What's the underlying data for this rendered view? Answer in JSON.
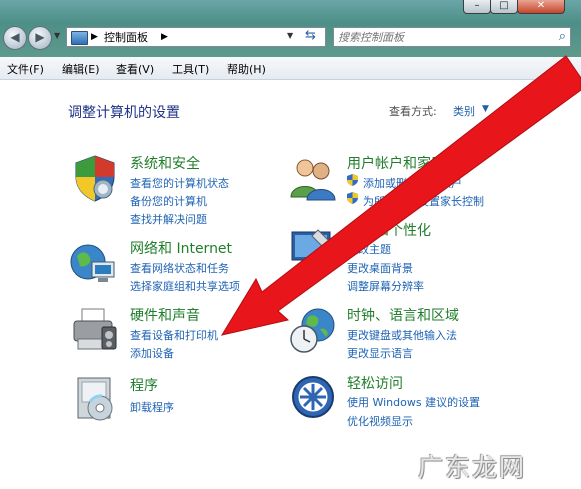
{
  "address": {
    "segments": [
      "控制面板"
    ],
    "search_placeholder": "搜索控制面板"
  },
  "window_controls": [
    "–",
    "□",
    "✕"
  ],
  "menu": [
    "文件(F)",
    "编辑(E)",
    "查看(V)",
    "工具(T)",
    "帮助(H)"
  ],
  "heading": "调整计算机的设置",
  "view": {
    "label": "查看方式:",
    "value": "类别"
  },
  "categories": [
    {
      "title": "系统和安全",
      "icon": "shield-icon",
      "links": [
        "查看您的计算机状态",
        "备份您的计算机",
        "查找并解决问题"
      ]
    },
    {
      "title": "网络和 Internet",
      "icon": "network-icon",
      "links": [
        "查看网络状态和任务",
        "选择家庭组和共享选项"
      ]
    },
    {
      "title": "硬件和声音",
      "icon": "printer-icon",
      "links": [
        "查看设备和打印机",
        "添加设备"
      ]
    },
    {
      "title": "程序",
      "icon": "programs-icon",
      "links": [
        "卸载程序"
      ]
    },
    {
      "title": "用户帐户和家庭安全",
      "icon": "users-icon",
      "links": [
        "添加或删除用户帐户",
        "为所有用户设置家长控制"
      ]
    },
    {
      "title": "外观和个性化",
      "icon": "appearance-icon",
      "links": [
        "更改主题",
        "更改桌面背景",
        "调整屏幕分辨率"
      ]
    },
    {
      "title": "时钟、语言和区域",
      "icon": "clock-globe-icon",
      "links": [
        "更改键盘或其他输入法",
        "更改显示语言"
      ]
    },
    {
      "title": "轻松访问",
      "icon": "ease-of-access-icon",
      "links": [
        "使用 Windows 建议的设置",
        "优化视频显示"
      ]
    }
  ],
  "watermark": "广东龙网",
  "accent_colors": {
    "category_title": "#1f7e2b",
    "link": "#1e63b4",
    "heading": "#1e3287",
    "arrow": "#e8151b"
  }
}
